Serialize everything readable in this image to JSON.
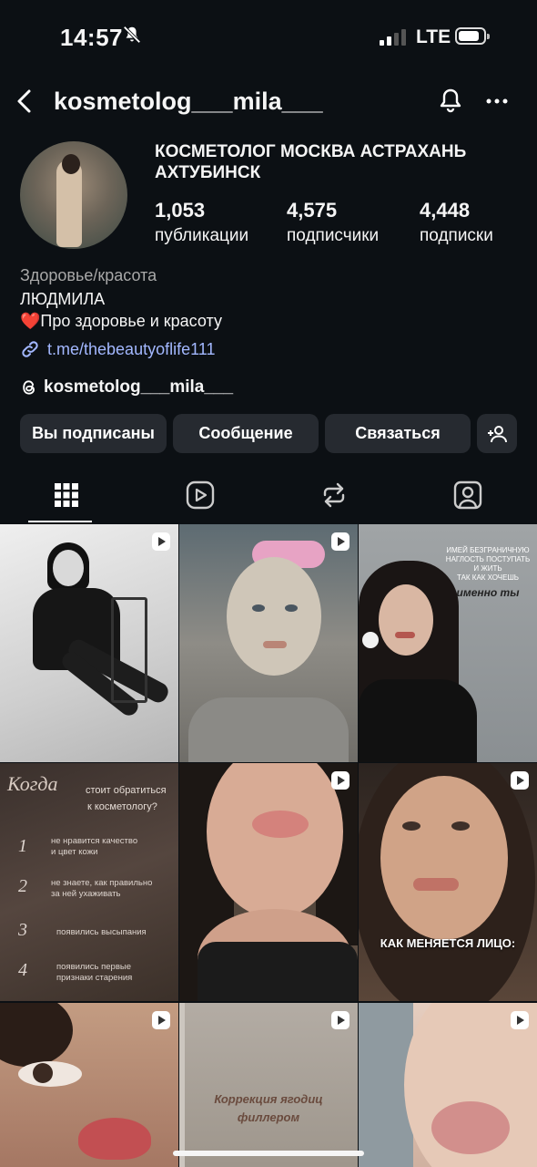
{
  "status": {
    "time": "14:57",
    "network": "LTE"
  },
  "header": {
    "username": "kosmetolog___mila___"
  },
  "profile": {
    "display_title": "КОСМЕТОЛОГ МОСКВА АСТРАХАНЬ АХТУБИНСК",
    "stats": [
      {
        "value": "1,053",
        "label": "публикации"
      },
      {
        "value": "4,575",
        "label": "подписчики"
      },
      {
        "value": "4,448",
        "label": "подписки"
      }
    ],
    "category": "Здоровье/красота",
    "name": "ЛЮДМИЛА",
    "tagline_emoji": "❤️",
    "tagline": "Про здоровье и красоту",
    "link": "t.me/thebeautyoflife111",
    "threads_handle": "kosmetolog___mila___"
  },
  "buttons": {
    "following": "Вы подписаны",
    "message": "Сообщение",
    "contact": "Связаться"
  },
  "tabs": [
    "grid-icon",
    "reels-icon",
    "reposts-icon",
    "tagged-icon"
  ],
  "posts": {
    "post3_line1": "ИМЕЙ БЕЗГРАНИЧНУЮ",
    "post3_line2": "НАГЛОСТЬ ПОСТУПАТЬ",
    "post3_line3": "И ЖИТЬ",
    "post3_line4": "ТАК КАК ХОЧЕШЬ",
    "post3_line5": "именно ты",
    "post4_script": "Когда",
    "post4_head1": "стоит обратиться",
    "post4_head2": "к косметологу?",
    "post4_items": [
      {
        "num": "1",
        "l1": "не нравится качество",
        "l2": "и цвет кожи"
      },
      {
        "num": "2",
        "l1": "не знаете, как правильно",
        "l2": "за ней ухаживать"
      },
      {
        "num": "3",
        "l1": "появились высыпания",
        "l2": ""
      },
      {
        "num": "4",
        "l1": "появились первые",
        "l2": "признаки старения"
      }
    ],
    "post6_caption": "КАК МЕНЯЕТСЯ ЛИЦО:",
    "post8_line1": "Коррекция ягодиц",
    "post8_line2": "филлером"
  }
}
